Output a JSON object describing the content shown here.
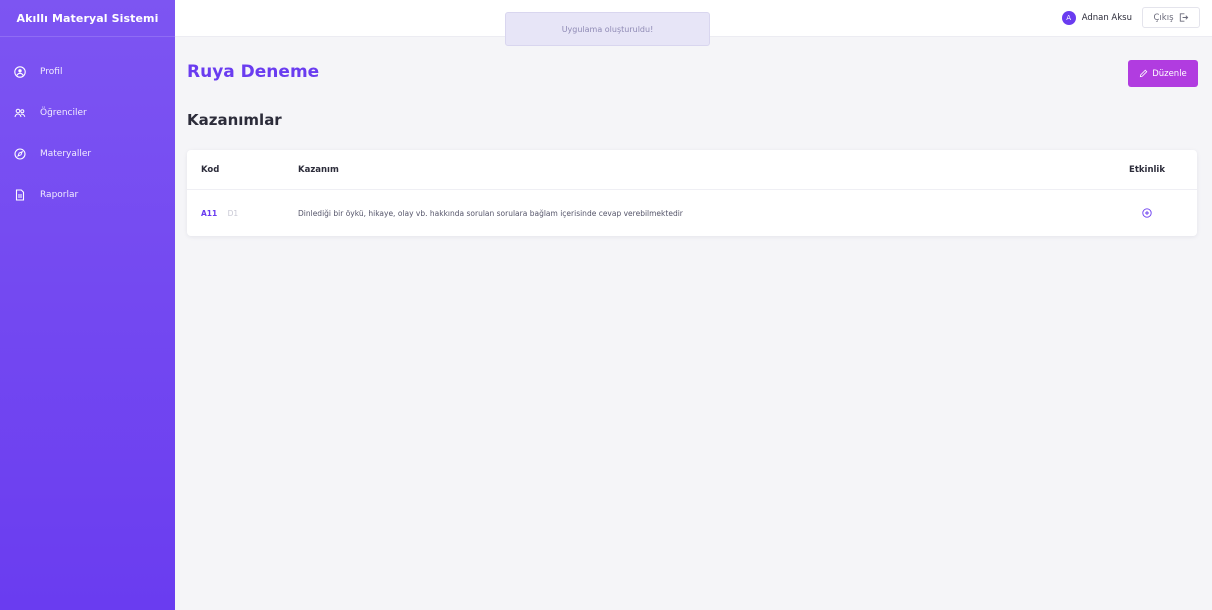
{
  "sidebar": {
    "brand": "Akıllı Materyal Sistemi",
    "items": [
      {
        "label": "Profil",
        "icon": "profile-icon"
      },
      {
        "label": "Öğrenciler",
        "icon": "users-icon"
      },
      {
        "label": "Materyaller",
        "icon": "compass-icon"
      },
      {
        "label": "Raporlar",
        "icon": "document-icon"
      }
    ]
  },
  "header": {
    "toast": "Uygulama oluşturuldu!",
    "user_initial": "A",
    "user_name": "Adnan Aksu",
    "logout_label": "Çıkış"
  },
  "main": {
    "title": "Ruya Deneme",
    "edit_label": "Düzenle",
    "section_title": "Kazanımlar",
    "table": {
      "headers": {
        "code": "Kod",
        "kazanim": "Kazanım",
        "activity": "Etkinlik"
      },
      "rows": [
        {
          "code": "A11",
          "badge": "D1",
          "kazanim": "Dinlediği bir öykü, hikaye, olay vb. hakkında sorulan sorulara bağlam içerisinde cevap verebilmektedir"
        }
      ]
    }
  },
  "colors": {
    "brand": "#6a3cf0",
    "accent_button": "#b13ce0"
  }
}
